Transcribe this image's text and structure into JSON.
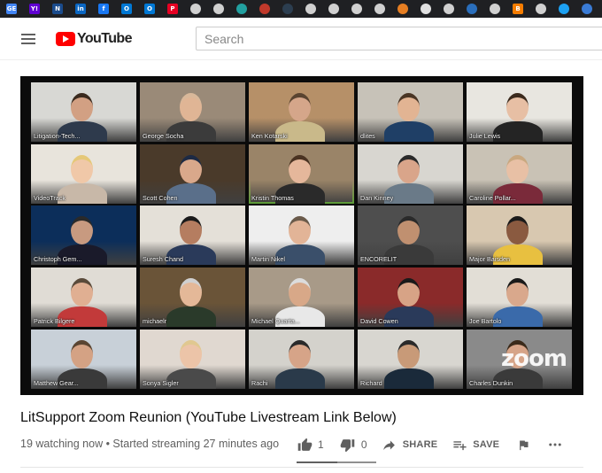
{
  "header": {
    "logo_text": "YouTube",
    "search_placeholder": "Search"
  },
  "bookmarks": [
    {
      "icon": "google-icon",
      "text": "GE",
      "color": "#4285f4"
    },
    {
      "icon": "yahoo-icon",
      "text": "Y!",
      "color": "#6001d2"
    },
    {
      "icon": "news-icon",
      "text": "N",
      "color": "#1a4b8c"
    },
    {
      "icon": "linkedin-icon",
      "text": "in",
      "color": "#0a66c2"
    },
    {
      "icon": "facebook-icon",
      "text": "f",
      "color": "#1877f2"
    },
    {
      "icon": "outlook-icon",
      "text": "O",
      "color": "#0078d4"
    },
    {
      "icon": "outlook-icon",
      "text": "O",
      "color": "#0078d4"
    },
    {
      "icon": "pinterest-icon",
      "text": "P",
      "color": "#e60023"
    },
    {
      "icon": "bookmark-icon",
      "text": "",
      "color": "#d0d0d0"
    },
    {
      "icon": "bookmark-icon",
      "text": "",
      "color": "#d0d0d0"
    },
    {
      "icon": "bookmark-icon",
      "text": "",
      "color": "#22a0a0"
    },
    {
      "icon": "bookmark-icon",
      "text": "",
      "color": "#c0392b"
    },
    {
      "icon": "bookmark-icon",
      "text": "",
      "color": "#2c3e50"
    },
    {
      "icon": "bookmark-icon",
      "text": "",
      "color": "#d0d0d0"
    },
    {
      "icon": "bookmark-icon",
      "text": "",
      "color": "#d0d0d0"
    },
    {
      "icon": "bookmark-icon",
      "text": "",
      "color": "#d0d0d0"
    },
    {
      "icon": "bookmark-icon",
      "text": "",
      "color": "#d0d0d0"
    },
    {
      "icon": "bookmark-icon",
      "text": "",
      "color": "#e67e22"
    },
    {
      "icon": "bookmark-icon",
      "text": "",
      "color": "#e0e0e0"
    },
    {
      "icon": "bookmark-icon",
      "text": "",
      "color": "#d0d0d0"
    },
    {
      "icon": "bookmark-icon",
      "text": "",
      "color": "#2a6ebb"
    },
    {
      "icon": "bookmark-icon",
      "text": "",
      "color": "#d0d0d0"
    },
    {
      "icon": "blogger-icon",
      "text": "B",
      "color": "#f57d00"
    },
    {
      "icon": "bookmark-icon",
      "text": "",
      "color": "#d0d0d0"
    },
    {
      "icon": "twitter-icon",
      "text": "",
      "color": "#1da1f2"
    },
    {
      "icon": "bookmark-icon",
      "text": "",
      "color": "#3a7bd5"
    },
    {
      "icon": "bookmark-icon",
      "text": "",
      "color": "#e74c3c"
    },
    {
      "icon": "bookmark-icon",
      "text": "",
      "color": "#d0d0d0"
    }
  ],
  "participants": [
    {
      "name": "Litigation-Tech...",
      "wall": "#d8d8d4",
      "skin": "#d2a083",
      "shirt": "#2e3a4c",
      "hair": "#3a2a1e"
    },
    {
      "name": "George Socha",
      "wall": "#9a8a78",
      "skin": "#e0b595",
      "shirt": "#3b3b3b",
      "hair": "#d9b89a"
    },
    {
      "name": "Ken Kotarski",
      "wall": "#b69068",
      "skin": "#d5a68a",
      "shirt": "#c9b98a",
      "hair": "#5a4430"
    },
    {
      "name": "dlites",
      "wall": "#c7c2b8",
      "skin": "#e2b493",
      "shirt": "#1f3f66",
      "hair": "#4a3524"
    },
    {
      "name": "Julie Lewis",
      "wall": "#e8e6e0",
      "skin": "#e7bfa4",
      "shirt": "#242424",
      "hair": "#3b2a1d"
    },
    {
      "name": "VideoTrack",
      "wall": "#e8e4dc",
      "skin": "#f0c8a8",
      "shirt": "#c8b8a8",
      "hair": "#e5c878"
    },
    {
      "name": "Scott Cohen",
      "wall": "#4a3a2a",
      "skin": "#d9a88b",
      "shirt": "#5a6f8a",
      "hair": "#1d2a44"
    },
    {
      "name": "Kristin Thomas",
      "wall": "#9a8468",
      "skin": "#e5b79b",
      "shirt": "#2a2a2a",
      "hair": "#4a3322"
    },
    {
      "name": "Dan Kinney",
      "wall": "#d8d6d0",
      "skin": "#d9a58a",
      "shirt": "#6a7a88",
      "hair": "#2a2a2a"
    },
    {
      "name": "Caroline Pollar...",
      "wall": "#c9c2b5",
      "skin": "#e8c0a5",
      "shirt": "#7a2a3a",
      "hair": "#c9a880"
    },
    {
      "name": "Christoph Gem...",
      "wall": "#0c2e5a",
      "skin": "#c89a80",
      "shirt": "#1a1a2a",
      "hair": "#2a2a2a"
    },
    {
      "name": "Suresh Chand",
      "wall": "#e4e0d8",
      "skin": "#b57d60",
      "shirt": "#2a3a5a",
      "hair": "#1a1a1a"
    },
    {
      "name": "Martin Nikel",
      "wall": "#eeeeee",
      "skin": "#e2b497",
      "shirt": "#3a4f6a",
      "hair": "#6a5a4a"
    },
    {
      "name": "ENCORELIT",
      "wall": "#4e4e4e",
      "skin": "#c09070",
      "shirt": "#3a3a3a",
      "hair": "#2a2a2a"
    },
    {
      "name": "Major Baisden",
      "wall": "#d8c8b0",
      "skin": "#8a5a40",
      "shirt": "#e8c040",
      "hair": "#1a1a1a"
    },
    {
      "name": "Patrick Bilgere",
      "wall": "#e0dcd5",
      "skin": "#e0af92",
      "shirt": "#c23a3a",
      "hair": "#5a4a3a"
    },
    {
      "name": "michaelr",
      "wall": "#6a5438",
      "skin": "#e4b898",
      "shirt": "#2a3a2a",
      "hair": "#d0d0d0"
    },
    {
      "name": "Michael Quarta...",
      "wall": "#a89a88",
      "skin": "#d8a888",
      "shirt": "#e8e8e8",
      "hair": "#dcdcdc"
    },
    {
      "name": "David Cowen",
      "wall": "#8a2a2a",
      "skin": "#d7a386",
      "shirt": "#2a3a5a",
      "hair": "#1a1a1a"
    },
    {
      "name": "Joe Bartolo",
      "wall": "#e2ded6",
      "skin": "#d9a88c",
      "shirt": "#3a6aaa",
      "hair": "#1a1a1a"
    },
    {
      "name": "Matthew Gear...",
      "wall": "#c8d0d8",
      "skin": "#d4a284",
      "shirt": "#3a3a3a",
      "hair": "#5a4532"
    },
    {
      "name": "Sonya Sigler",
      "wall": "#e0d8d0",
      "skin": "#ecc4a8",
      "shirt": "#4a4a4a",
      "hair": "#e0c890"
    },
    {
      "name": "Rachi",
      "wall": "#d4d2cc",
      "skin": "#d6a488",
      "shirt": "#2a3a4a",
      "hair": "#2a2a2a"
    },
    {
      "name": "Richard",
      "wall": "#d8d6d0",
      "skin": "#c89a78",
      "shirt": "#1a2a3a",
      "hair": "#2a2a2a"
    },
    {
      "name": "Charles Dunkin",
      "wall": "#8a8a8a",
      "skin": "#d6a488",
      "shirt": "#3a3a3a",
      "hair": "#3a2a1a"
    }
  ],
  "player": {
    "watermark": "zoom",
    "active_tile": "Kristin Thomas"
  },
  "video": {
    "title": "LitSupport Zoom Reunion (YouTube Livestream Link Below)",
    "meta": "19 watching now • Started streaming 27 minutes ago",
    "likes": "1",
    "dislikes": "0",
    "share_label": "SHARE",
    "save_label": "SAVE",
    "like_ratio": 1.0
  }
}
